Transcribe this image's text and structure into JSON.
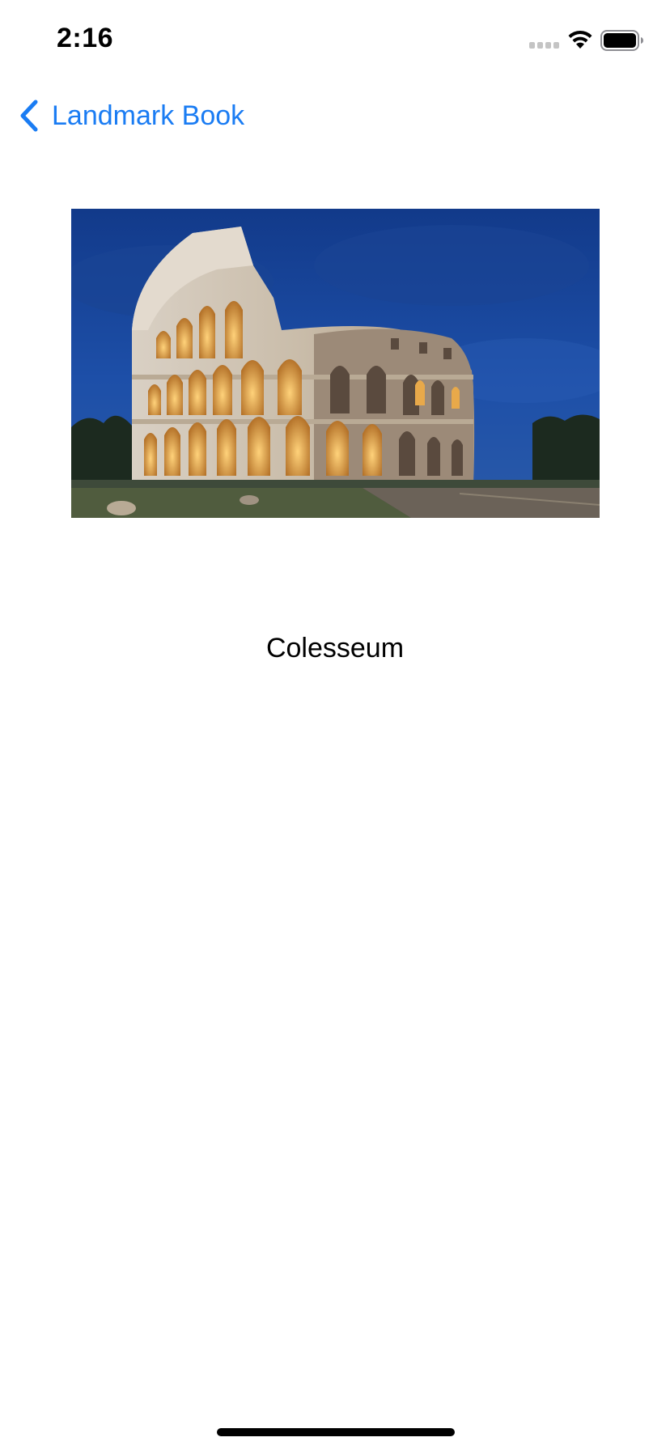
{
  "status_bar": {
    "time": "2:16",
    "icons": [
      "cellular-signal-icon",
      "wifi-icon",
      "battery-icon"
    ]
  },
  "nav": {
    "back_label": "Landmark Book",
    "back_icon": "chevron-left-icon"
  },
  "landmark": {
    "name": "Colesseum"
  },
  "colors": {
    "accent": "#1a7cf3",
    "text": "#000000",
    "background": "#ffffff"
  }
}
